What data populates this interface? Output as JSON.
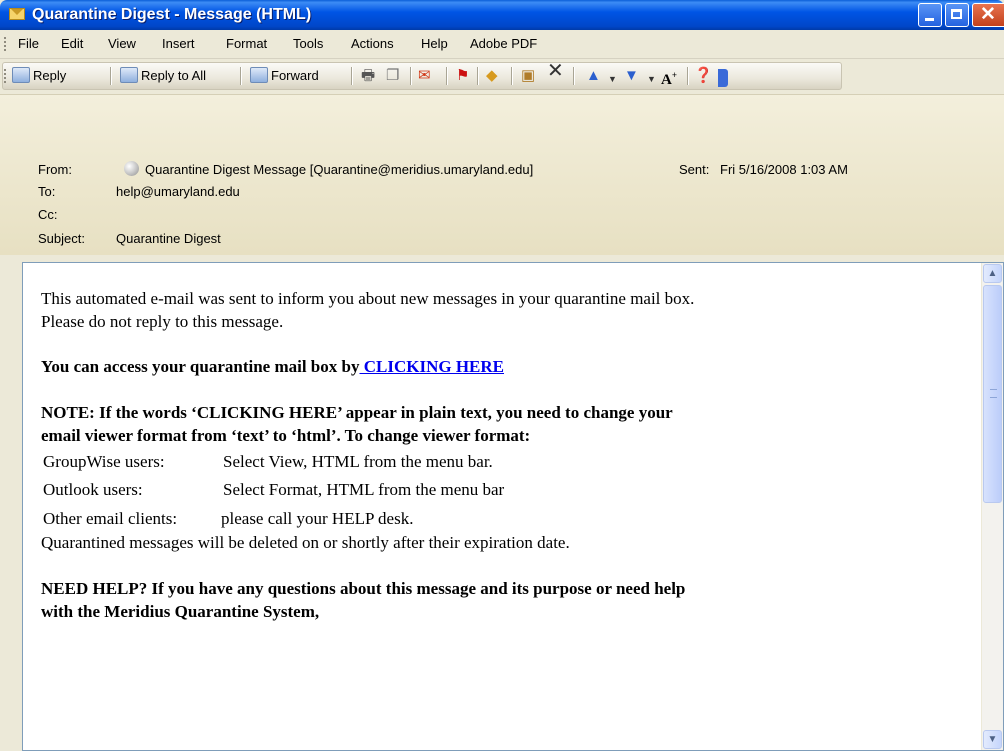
{
  "window": {
    "title": "Quarantine Digest - Message (HTML)"
  },
  "menu": [
    "File",
    "Edit",
    "View",
    "Insert",
    "Format",
    "Tools",
    "Actions",
    "Help",
    "Adobe PDF"
  ],
  "toolbar": {
    "reply": "Reply",
    "reply_all": "Reply to All",
    "forward": "Forward"
  },
  "header": {
    "from_label": "From:",
    "from_value": "Quarantine Digest Message [Quarantine@meridius.umaryland.edu]",
    "sent_label": "Sent:",
    "sent_value": "Fri 5/16/2008 1:03 AM",
    "to_label": "To:",
    "to_value": "help@umaryland.edu",
    "cc_label": "Cc:",
    "cc_value": "",
    "subject_label": "Subject:",
    "subject_value": "Quarantine Digest"
  },
  "body": {
    "intro_line1": "This automated e-mail was sent to inform you about new messages in your quarantine mail box.",
    "intro_line2": "Please do not reply to this message.",
    "access_text": "You can access your quarantine mail box by",
    "access_link": " CLICKING HERE",
    "note_line1": "NOTE: If the words ‘CLICKING HERE’ appear in plain text, you need to change your",
    "note_line2": "email viewer format from ‘text’ to ‘html’. To change viewer format:",
    "groupwise_label": "GroupWise users:",
    "groupwise_text": "Select View, HTML from the menu bar.",
    "outlook_label": "Outlook users:",
    "outlook_text": "Select Format, HTML from the menu bar",
    "other_label": "Other email clients:",
    "other_text": "please call your HELP desk.",
    "expiration": "Quarantined messages will be deleted on or shortly after their expiration date.",
    "help_line1": "NEED HELP? If you have any questions about this message and its purpose or need help",
    "help_line2": "with the Meridius Quarantine System,"
  },
  "colors": {
    "titlebar": "#0055e5",
    "link": "#0000ee",
    "header_bg": "#efe9d2"
  }
}
